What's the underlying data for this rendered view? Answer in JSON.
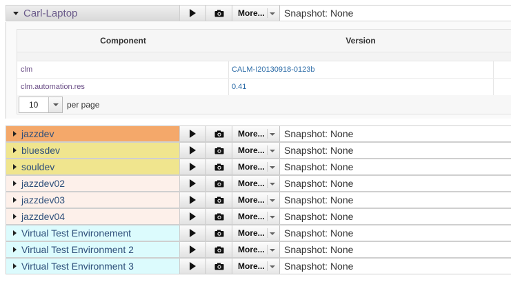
{
  "expanded_env": {
    "name": "Carl-Laptop",
    "more_label": "More...",
    "snapshot": "Snapshot: None",
    "table": {
      "headers": [
        "Component",
        "Version"
      ],
      "rows": [
        {
          "component": "clm",
          "version": "CALM-I20130918-0123b"
        },
        {
          "component": "clm.automation.res",
          "version": "0.41"
        }
      ],
      "page_size": "10",
      "per_page_label": "per page"
    }
  },
  "environments": [
    {
      "name": "jazzdev",
      "color": "#f4a86a",
      "more_label": "More...",
      "snapshot": "Snapshot: None"
    },
    {
      "name": "bluesdev",
      "color": "#f0e58e",
      "more_label": "More...",
      "snapshot": "Snapshot: None"
    },
    {
      "name": "souldev",
      "color": "#f0e58e",
      "more_label": "More...",
      "snapshot": "Snapshot: None"
    },
    {
      "name": "jazzdev02",
      "color": "#fdf0ea",
      "more_label": "More...",
      "snapshot": "Snapshot: None"
    },
    {
      "name": "jazzdev03",
      "color": "#fdf0ea",
      "more_label": "More...",
      "snapshot": "Snapshot: None"
    },
    {
      "name": "jazzdev04",
      "color": "#fdf0ea",
      "more_label": "More...",
      "snapshot": "Snapshot: None"
    },
    {
      "name": "Virtual Test Environement",
      "color": "#dcfbfd",
      "more_label": "More...",
      "snapshot": "Snapshot: None"
    },
    {
      "name": "Virtual Test Environment 2",
      "color": "#dcfbfd",
      "more_label": "More...",
      "snapshot": "Snapshot: None"
    },
    {
      "name": "Virtual Test Environment 3",
      "color": "#dcfbfd",
      "more_label": "More...",
      "snapshot": "Snapshot: None"
    }
  ],
  "icons": {
    "expand": "triangle-right-icon",
    "collapse": "triangle-down-icon",
    "run": "play-icon",
    "snapshot": "camera-icon"
  }
}
